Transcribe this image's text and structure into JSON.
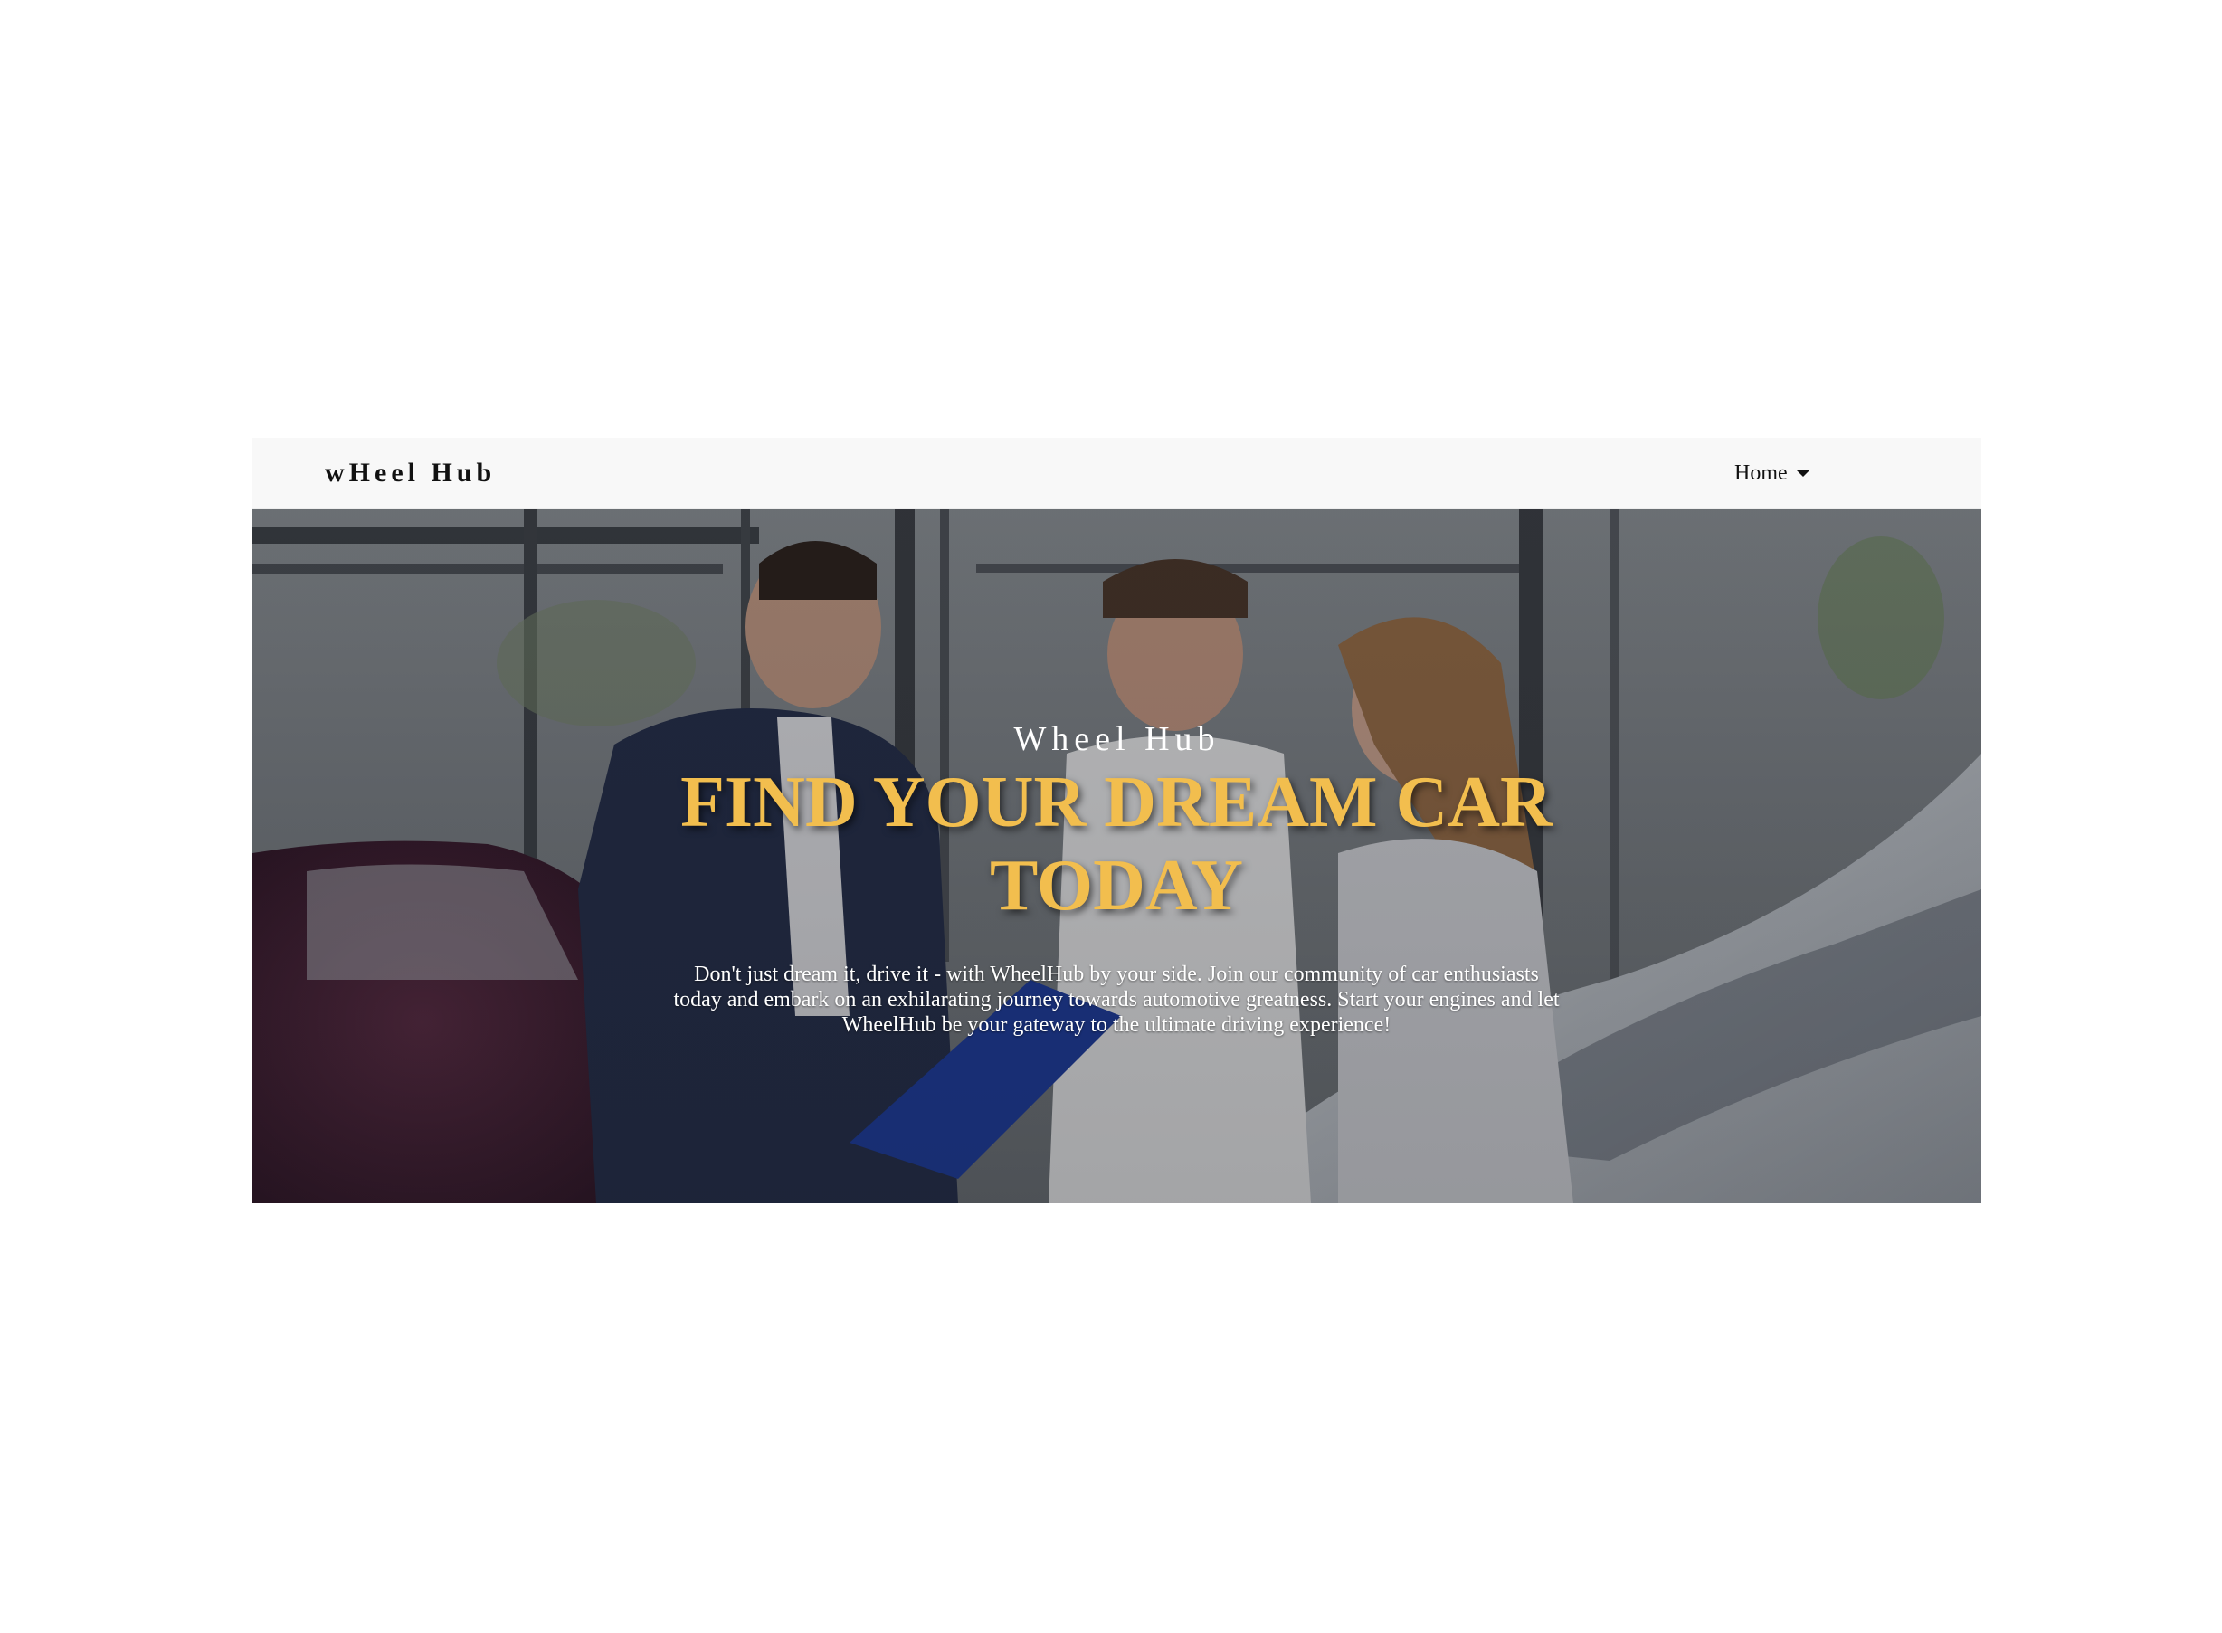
{
  "navbar": {
    "brand": "wHeel Hub",
    "home_label": "Home"
  },
  "hero": {
    "kicker": "Wheel Hub",
    "title": "FIND YOUR DREAM CAR TODAY",
    "description": "Don't just dream it, drive it - with WheelHub by your side. Join our community of car enthusiasts today and embark on an exhilarating journey towards automotive greatness. Start your engines and let WheelHub be your gateway to the ultimate driving experience!"
  },
  "colors": {
    "navbar_bg": "#f8f8f8",
    "title_accent": "#f2be4e",
    "text_light": "#ffffff"
  }
}
